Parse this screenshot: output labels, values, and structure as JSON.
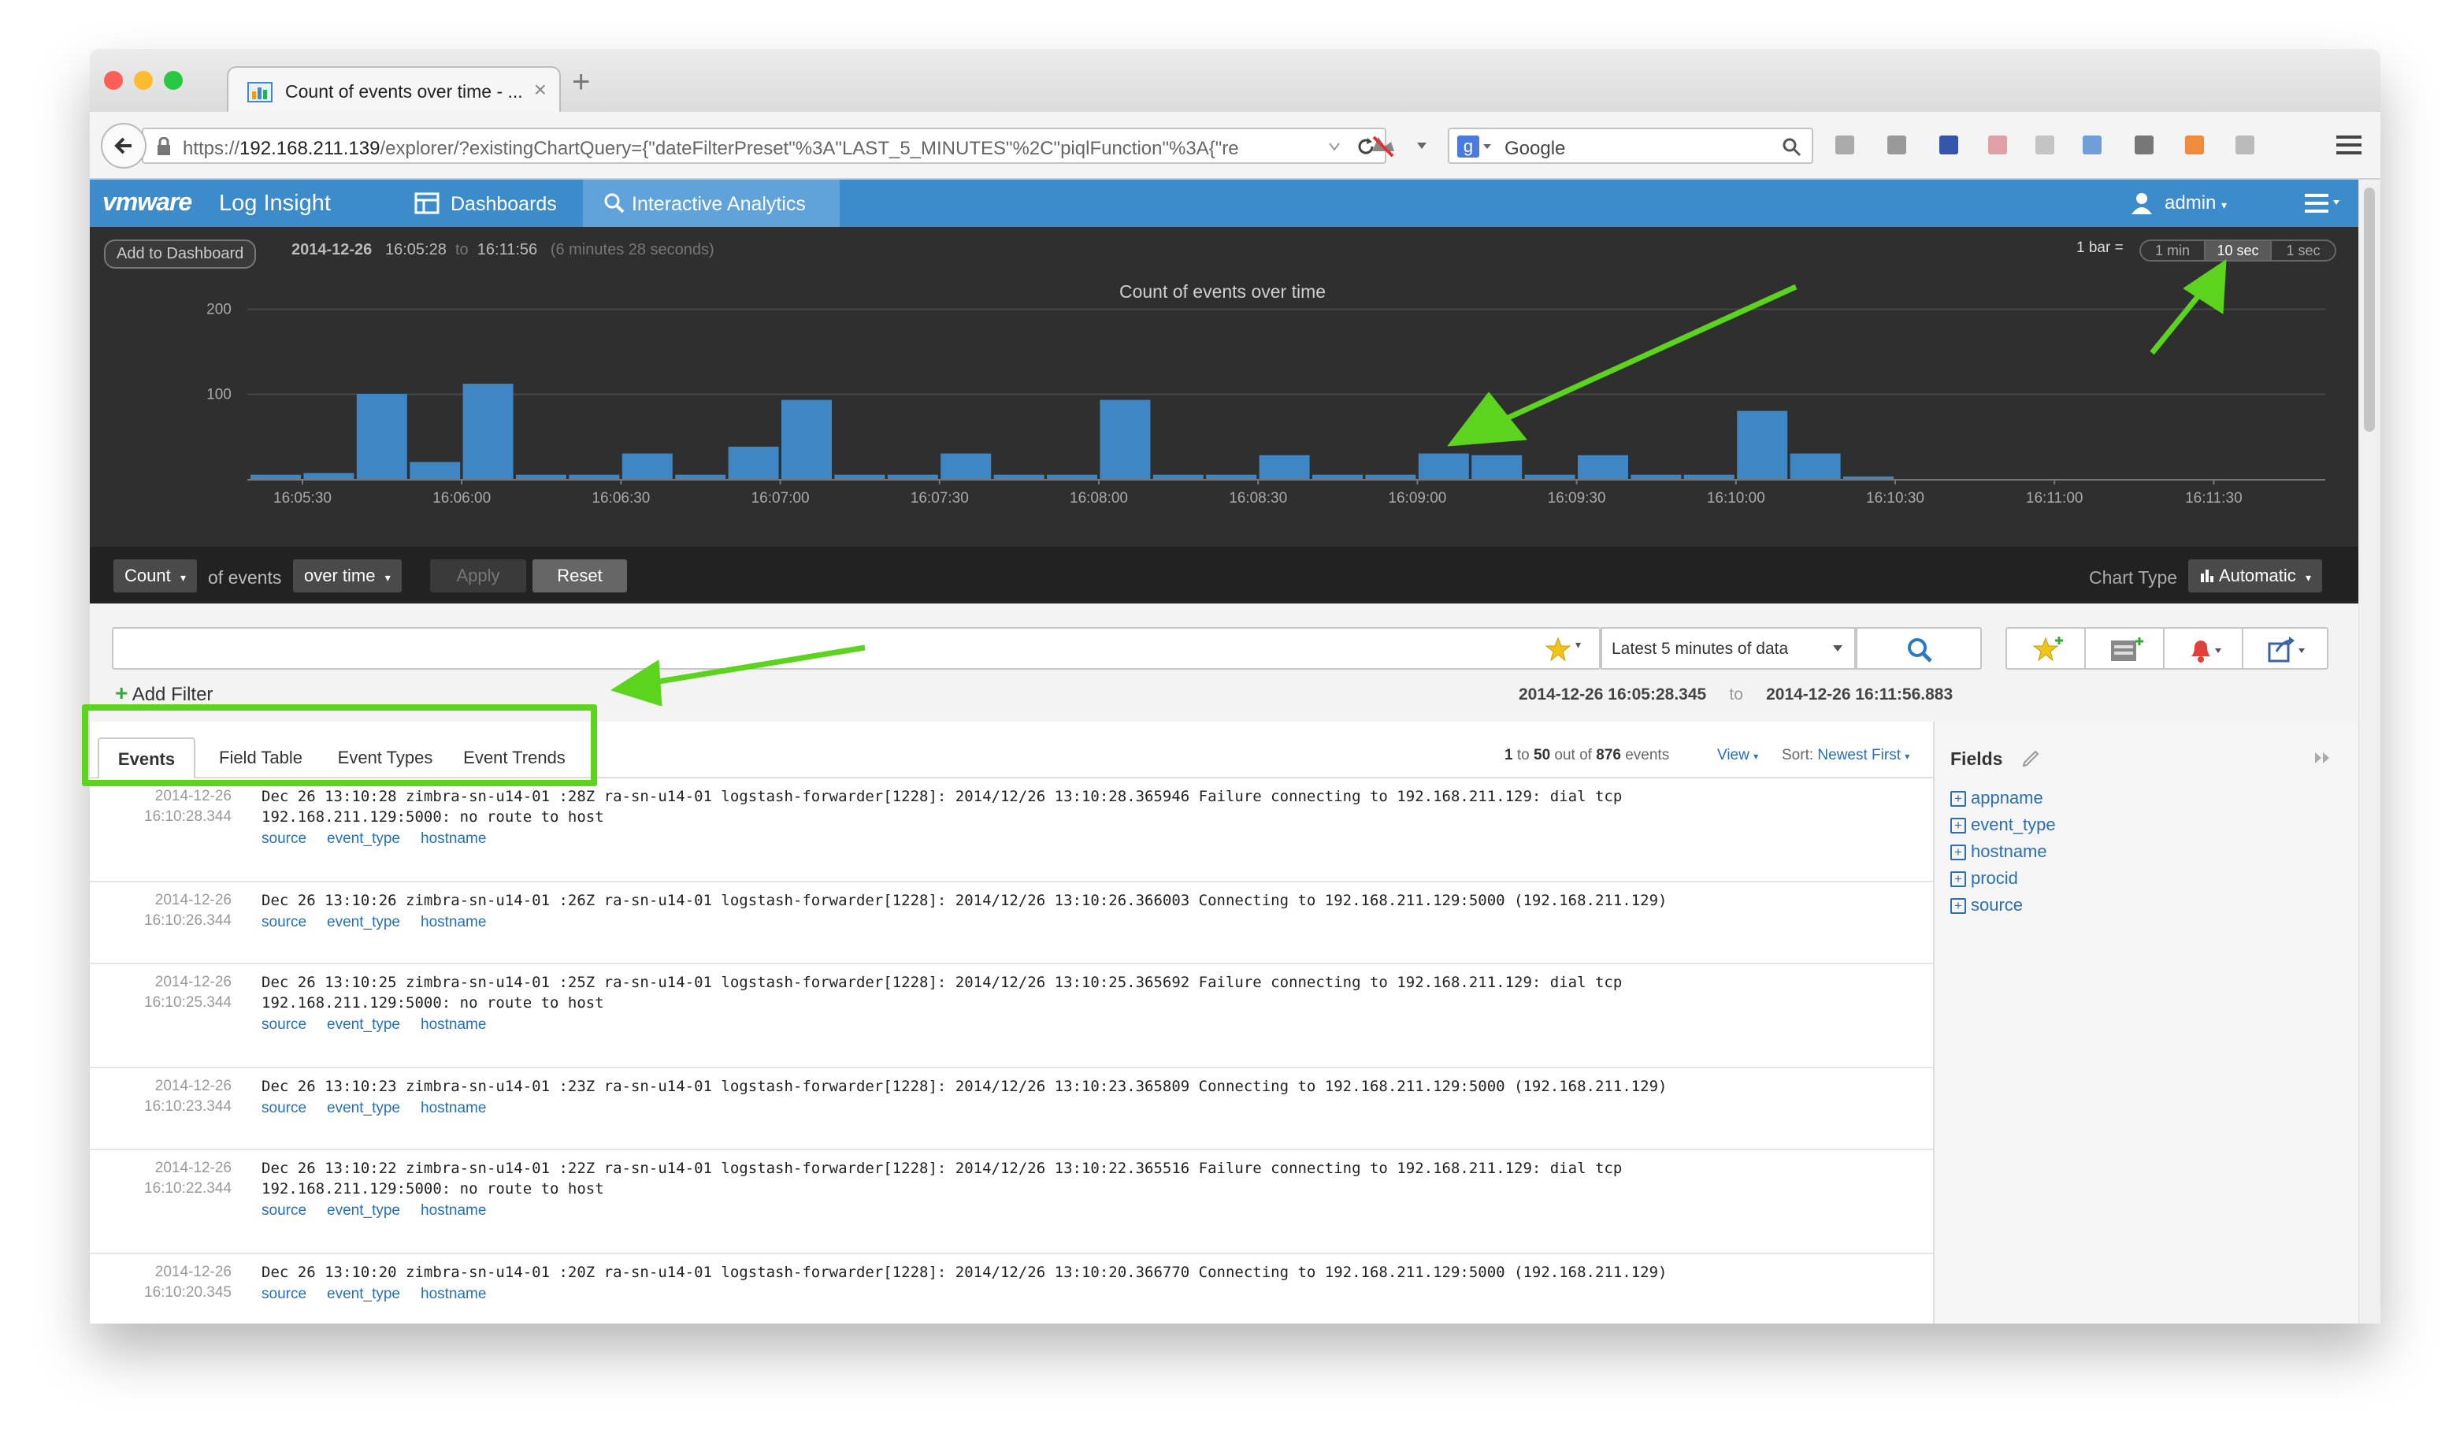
{
  "browser": {
    "tab_title": "Count of events over time - ...",
    "url_prefix": "https://",
    "url_host": "192.168.211.139",
    "url_rest": "/explorer/?existingChartQuery={\"dateFilterPreset\"%3A\"LAST_5_MINUTES\"%2C\"piqlFunction\"%3A{\"re",
    "search_placeholder": "Google",
    "colors": {
      "close": "#fc5f57",
      "minimize": "#fdbc2e",
      "maximize": "#28c941"
    }
  },
  "app": {
    "logo_brand": "vmware",
    "logo_product": "Log Insight",
    "nav": {
      "dashboards": "Dashboards",
      "interactive": "Interactive Analytics"
    },
    "user": "admin",
    "accent": "#3c8bcb"
  },
  "chart_header": {
    "add_to_dashboard": "Add to Dashboard",
    "date": "2014-12-26",
    "start": "16:05:28",
    "to": "to",
    "end": "16:11:56",
    "duration": "(6 minutes 28 seconds)",
    "bar_label": "1 bar =",
    "bar_options": [
      "1 min",
      "10 sec",
      "1 sec"
    ],
    "bar_selected": "10 sec"
  },
  "chart_data": {
    "type": "bar",
    "title": "Count of events over time",
    "ylim": [
      0,
      200
    ],
    "y_ticks": [
      "200",
      "100"
    ],
    "x_ticks": [
      "16:05:30",
      "16:06:00",
      "16:06:30",
      "16:07:00",
      "16:07:30",
      "16:08:00",
      "16:08:30",
      "16:09:00",
      "16:09:30",
      "16:10:00",
      "16:10:30",
      "16:11:00",
      "16:11:30"
    ],
    "bar_color": "#3f87c4",
    "values": [
      5,
      7,
      100,
      20,
      112,
      5,
      5,
      30,
      5,
      38,
      93,
      5,
      5,
      30,
      5,
      5,
      93,
      5,
      5,
      28,
      5,
      5,
      30,
      28,
      5,
      28,
      5,
      5,
      80,
      30,
      3
    ]
  },
  "query": {
    "function": "Count",
    "of_events": "of events",
    "grouping": "over time",
    "apply": "Apply",
    "reset": "Reset",
    "chart_type_label": "Chart Type",
    "chart_type_value": "Automatic"
  },
  "filter": {
    "time_range": "Latest 5 minutes of data",
    "add_filter": "Add Filter",
    "date": "2014-12-26",
    "start": "16:05:28.345",
    "to": "to",
    "end": "16:11:56.883"
  },
  "results": {
    "tabs": [
      "Events",
      "Field Table",
      "Event Types",
      "Event Trends"
    ],
    "active_tab": "Events",
    "paging": {
      "from": "1",
      "to_word": "to",
      "to": "50",
      "out_of": "out of",
      "total": "876",
      "unit": "events"
    },
    "view": "View",
    "sort_label": "Sort:",
    "sort_value": "Newest First"
  },
  "events": [
    {
      "date": "2014-12-26",
      "time": "16:10:28.344",
      "msg": "Dec 26 13:10:28 zimbra-sn-u14-01 :28Z ra-sn-u14-01 logstash-forwarder[1228]: 2014/12/26 13:10:28.365946 Failure connecting to 192.168.211.129: dial tcp\n192.168.211.129:5000: no route to host",
      "tags": [
        "source",
        "event_type",
        "hostname"
      ]
    },
    {
      "date": "2014-12-26",
      "time": "16:10:26.344",
      "msg": "Dec 26 13:10:26 zimbra-sn-u14-01 :26Z ra-sn-u14-01 logstash-forwarder[1228]: 2014/12/26 13:10:26.366003 Connecting to 192.168.211.129:5000 (192.168.211.129)",
      "tags": [
        "source",
        "event_type",
        "hostname"
      ]
    },
    {
      "date": "2014-12-26",
      "time": "16:10:25.344",
      "msg": "Dec 26 13:10:25 zimbra-sn-u14-01 :25Z ra-sn-u14-01 logstash-forwarder[1228]: 2014/12/26 13:10:25.365692 Failure connecting to 192.168.211.129: dial tcp\n192.168.211.129:5000: no route to host",
      "tags": [
        "source",
        "event_type",
        "hostname"
      ]
    },
    {
      "date": "2014-12-26",
      "time": "16:10:23.344",
      "msg": "Dec 26 13:10:23 zimbra-sn-u14-01 :23Z ra-sn-u14-01 logstash-forwarder[1228]: 2014/12/26 13:10:23.365809 Connecting to 192.168.211.129:5000 (192.168.211.129)",
      "tags": [
        "source",
        "event_type",
        "hostname"
      ]
    },
    {
      "date": "2014-12-26",
      "time": "16:10:22.344",
      "msg": "Dec 26 13:10:22 zimbra-sn-u14-01 :22Z ra-sn-u14-01 logstash-forwarder[1228]: 2014/12/26 13:10:22.365516 Failure connecting to 192.168.211.129: dial tcp\n192.168.211.129:5000: no route to host",
      "tags": [
        "source",
        "event_type",
        "hostname"
      ]
    },
    {
      "date": "2014-12-26",
      "time": "16:10:20.345",
      "msg": "Dec 26 13:10:20 zimbra-sn-u14-01 :20Z ra-sn-u14-01 logstash-forwarder[1228]: 2014/12/26 13:10:20.366770 Connecting to 192.168.211.129:5000 (192.168.211.129)",
      "tags": [
        "source",
        "event_type",
        "hostname"
      ]
    }
  ],
  "fields_panel": {
    "title": "Fields",
    "items": [
      "appname",
      "event_type",
      "hostname",
      "procid",
      "source"
    ]
  },
  "annotation": {
    "color": "#5cd41e"
  }
}
